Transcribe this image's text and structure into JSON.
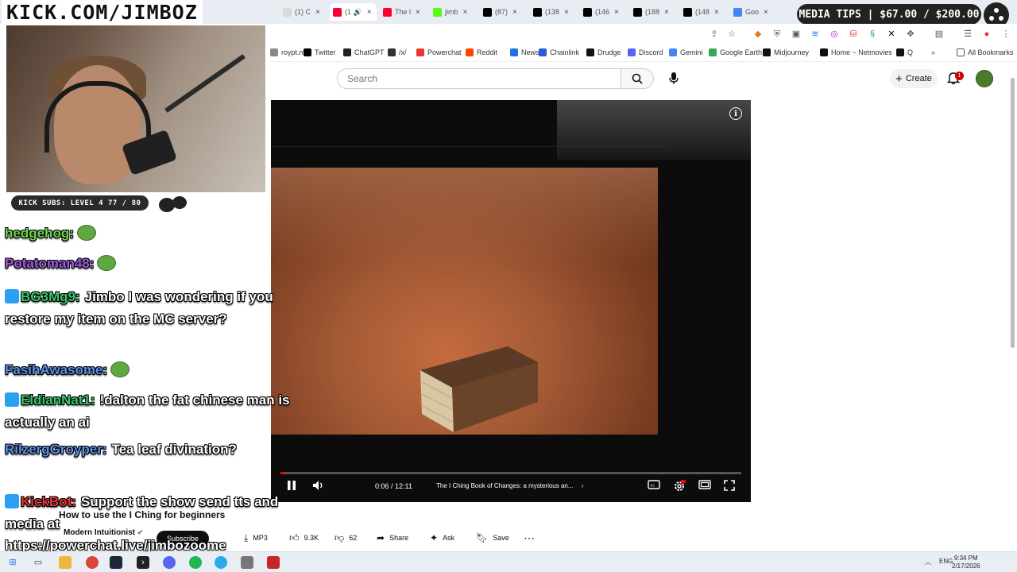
{
  "overlay": {
    "kick_url": "KICK.COM/JIMBOZ",
    "media_tips": "MEDIA TIPS | $67.00 / $200.00",
    "kick_subs": "KICK SUBS: LEVEL 4 77 / 80"
  },
  "tabs": [
    {
      "label": "(1) C",
      "color": "#d9d9d9"
    },
    {
      "label": "(1 🔊",
      "color": "#ff0033",
      "active": true
    },
    {
      "label": "The l",
      "color": "#ff0033"
    },
    {
      "label": "jimb",
      "color": "#53fc18"
    },
    {
      "label": "(87)",
      "color": "#000000"
    },
    {
      "label": "(138",
      "color": "#000000"
    },
    {
      "label": "(146",
      "color": "#000000"
    },
    {
      "label": "(188",
      "color": "#000000"
    },
    {
      "label": "(148",
      "color": "#000000"
    },
    {
      "label": "Goo",
      "color": "#4285f4"
    }
  ],
  "bookmarks": [
    {
      "label": "roypt.me",
      "color": "#888888"
    },
    {
      "label": "Twitter",
      "color": "#000000"
    },
    {
      "label": "ChatGPT",
      "color": "#222222"
    },
    {
      "label": "/x/",
      "color": "#333333"
    },
    {
      "label": "Powerchat",
      "color": "#e33"
    },
    {
      "label": "Reddit",
      "color": "#ff4500"
    },
    {
      "label": "News",
      "color": "#1a73e8"
    },
    {
      "label": "Chainlink",
      "color": "#2a5ada"
    },
    {
      "label": "Drudge",
      "color": "#111111"
    },
    {
      "label": "Discord",
      "color": "#5865f2"
    },
    {
      "label": "Gemini",
      "color": "#4285f4"
    },
    {
      "label": "Google Earth",
      "color": "#34a853"
    },
    {
      "label": "Midjourney",
      "color": "#111111"
    },
    {
      "label": "Home ~ Netmovies",
      "color": "#0f0f0f"
    },
    {
      "label": "Q",
      "color": "#111111"
    }
  ],
  "all_bookmarks": "All Bookmarks",
  "youtube": {
    "search_placeholder": "Search",
    "create_label": "Create",
    "notification_count": "1"
  },
  "player": {
    "time": "0:06 / 12:11",
    "chapter": "The I Ching Book of Changes: a mysterious an...",
    "progress_fraction": 0.008
  },
  "video": {
    "title": "How to use the I Ching for beginners",
    "channel": "Modern Intuitionist",
    "subscribe_label": "Subscribe",
    "mp3_label": "MP3",
    "likes": "9.3K",
    "dislikes": "62",
    "share_label": "Share",
    "ask_label": "Ask",
    "save_label": "Save"
  },
  "chat": [
    {
      "user": "hedgehog:",
      "color": "#6fd44a",
      "text": ""
    },
    {
      "user": "Potatoman48:",
      "color": "#a05ae0",
      "text": ""
    },
    {
      "user": "BG3Mg9:",
      "color": "#37c86b",
      "text": "Jimbo I was wondering if you restore my item on the MC server?"
    },
    {
      "user": "FasihAwasome:",
      "color": "#5d8fe8",
      "text": ""
    },
    {
      "user": "EldianNat1:",
      "color": "#37c86b",
      "text": "!dalton the fat chinese man is actually an ai"
    },
    {
      "user": "RilzergGroyper:",
      "color": "#5d8fe8",
      "text": "Tea leaf divination?"
    },
    {
      "user": "KickBot:",
      "color": "#e33333",
      "text": "Support the show send tts and media at"
    }
  ],
  "chat_url": "https://powerchat.live/jimbozoome",
  "taskbar": {
    "lang": "ENG",
    "time": "9:34 PM",
    "date": "2/17/2026"
  }
}
